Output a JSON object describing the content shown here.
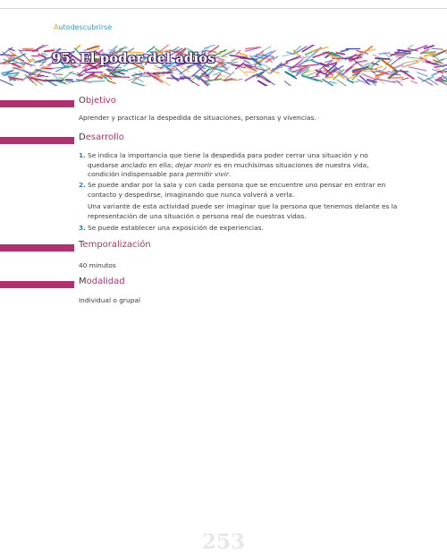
{
  "header": {
    "section_first": "A",
    "section_rest": "utodescubrirse"
  },
  "banner": {
    "title": "95. El poder del adiós"
  },
  "objetivo": {
    "cap": "O",
    "rest": "bjetivo",
    "text": "Aprender y practicar la despedida de situaciones, personas y vivencias."
  },
  "desarrollo": {
    "cap": "D",
    "rest": "esarrollo",
    "items": [
      {
        "num": "1.",
        "p1": "Se indica la importancia que tiene la despedida para poder cerrar una situación y no quedarse ",
        "i1": "anclado",
        "p2": " en ella; ",
        "i2": "dejar morir",
        "p3": " es en muchísimas situaciones de nuestra vida, condición indispensable para ",
        "i3": "permitir vivir",
        "p4": "."
      },
      {
        "num": "2.",
        "text": "Se puede andar por la sala y con cada persona que se encuentre uno pensar en entrar en contacto y despedirse, imaginando que nunca volverá a verla."
      },
      {
        "num": "3.",
        "text": "Se puede establecer una exposición de experiencias."
      }
    ],
    "note": "Una variante de esta actividad puede ser imaginar que la persona que tenemos delante es la representación de una situación o persona real de nuestras vidas."
  },
  "temporalizacion": {
    "cap": "T",
    "rest": "emporalización",
    "text": "40 minutos"
  },
  "modalidad": {
    "cap": "M",
    "rest": "odalidad",
    "text": "Individual o grupal"
  },
  "page": {
    "number": "253"
  },
  "colors": {
    "accent": "#b2306f",
    "link": "#2a9fc9",
    "number": "#2a7fc0"
  }
}
